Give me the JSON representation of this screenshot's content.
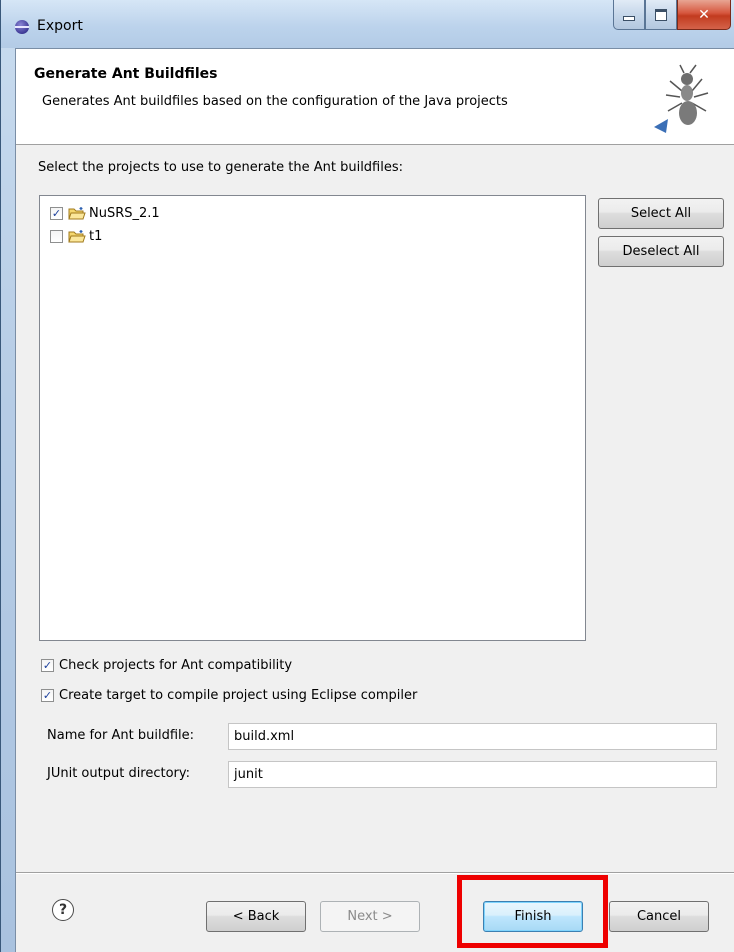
{
  "window": {
    "title": "Export"
  },
  "header": {
    "title": "Generate Ant Buildfiles",
    "description": "Generates Ant buildfiles based on the configuration of the Java projects"
  },
  "projects": {
    "label": "Select the projects to use to generate the Ant buildfiles:",
    "items": [
      {
        "name": "NuSRS_2.1",
        "checked": true
      },
      {
        "name": "t1",
        "checked": false
      }
    ],
    "select_all": "Select All",
    "deselect_all": "Deselect All"
  },
  "options": {
    "check_compat": {
      "label": "Check projects for Ant compatibility",
      "checked": true
    },
    "eclipse_compiler": {
      "label": "Create target to compile project using Eclipse compiler",
      "checked": true
    }
  },
  "fields": {
    "buildfile": {
      "label": "Name for Ant buildfile:",
      "value": "build.xml"
    },
    "junit": {
      "label": "JUnit output directory:",
      "value": "junit"
    }
  },
  "buttons": {
    "help": "?",
    "back": "< Back",
    "next": "Next >",
    "finish": "Finish",
    "cancel": "Cancel"
  },
  "colors": {
    "highlight": "#ee0000",
    "accent": "#3c7fb1"
  }
}
